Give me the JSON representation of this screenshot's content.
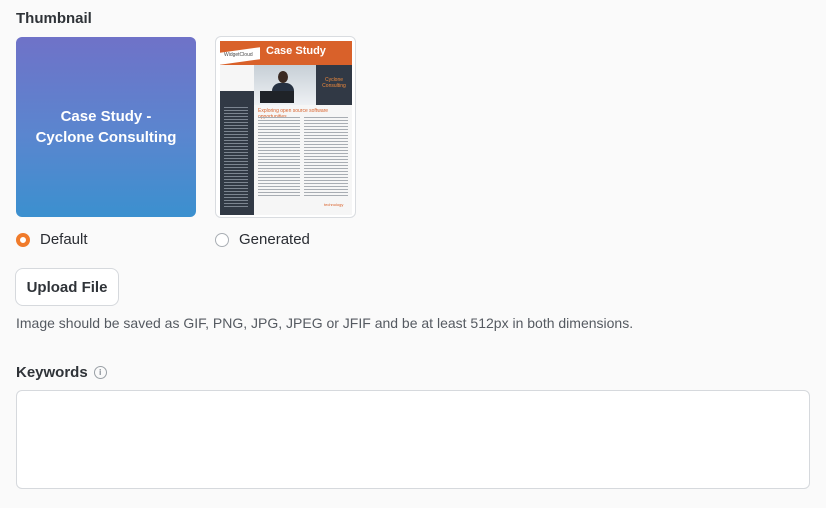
{
  "thumbnail": {
    "label": "Thumbnail",
    "default_card_text": "Case Study - Cyclone Consulting",
    "generated_preview": {
      "title": "Case Study",
      "logo_text": "WidgetCloud",
      "brand_text": "Cyclone Consulting",
      "body_heading": "Exploring open source software opportunities",
      "footer_logo": "technology"
    },
    "options": [
      {
        "label": "Default",
        "selected": true
      },
      {
        "label": "Generated",
        "selected": false
      }
    ],
    "accent_color": "#f07b2b"
  },
  "upload": {
    "button_label": "Upload File",
    "hint": "Image should be saved as GIF, PNG, JPG, JPEG or JFIF and be at least 512px in both dimensions."
  },
  "keywords": {
    "label": "Keywords",
    "value": "",
    "info_icon": "info-icon"
  }
}
